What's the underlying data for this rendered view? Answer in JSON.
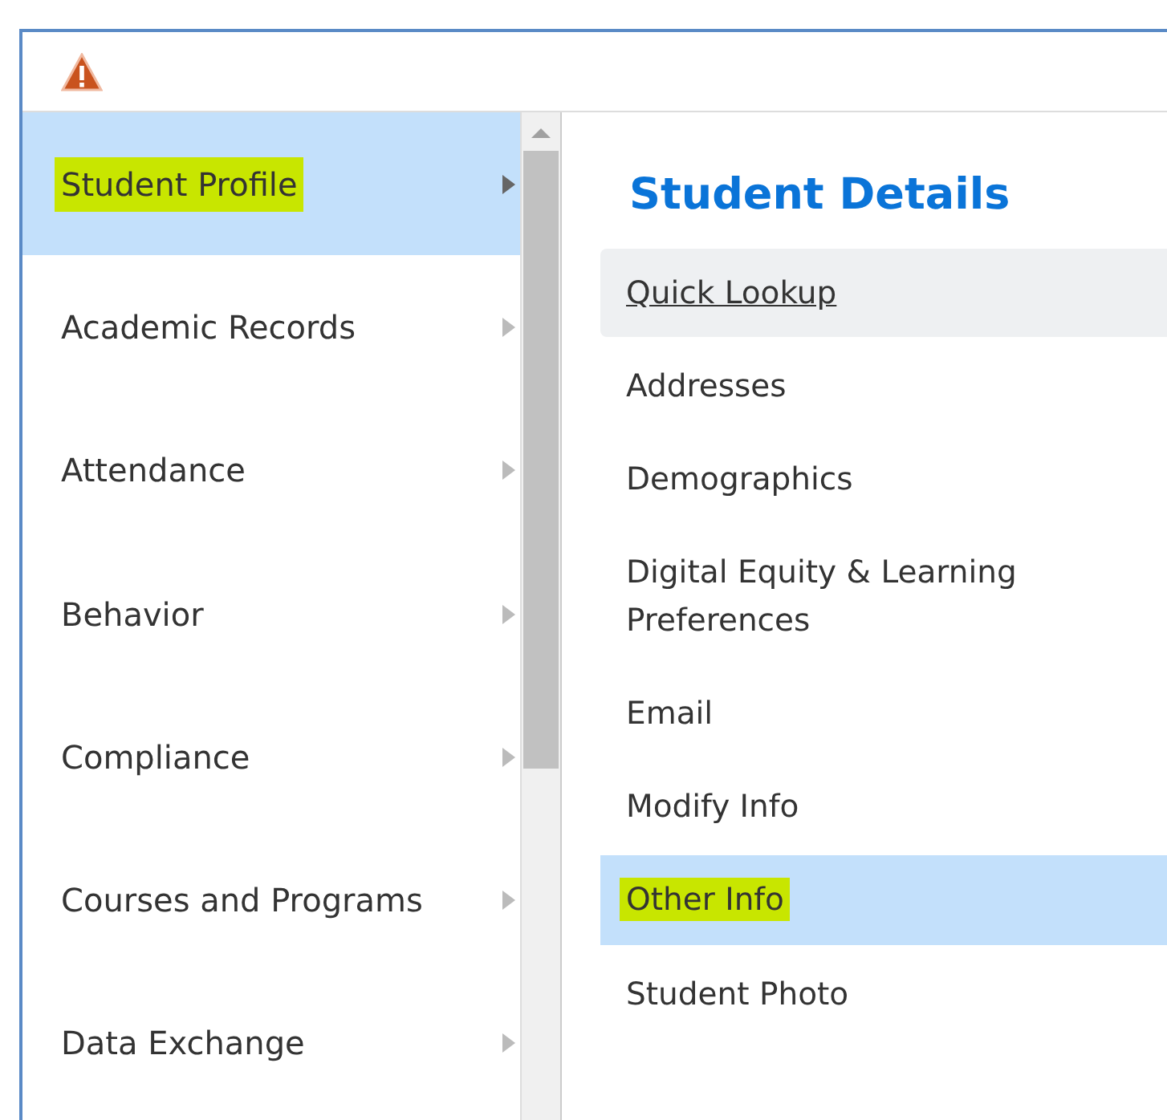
{
  "alert": {
    "kind": "warning"
  },
  "menu": {
    "items": [
      {
        "label": "Student Profile",
        "selected": true,
        "marked": true
      },
      {
        "label": "Academic Records",
        "selected": false,
        "marked": false
      },
      {
        "label": "Attendance",
        "selected": false,
        "marked": false
      },
      {
        "label": "Behavior",
        "selected": false,
        "marked": false
      },
      {
        "label": "Compliance",
        "selected": false,
        "marked": false
      },
      {
        "label": "Courses and Programs",
        "selected": false,
        "marked": false
      },
      {
        "label": "Data Exchange",
        "selected": false,
        "marked": false
      }
    ]
  },
  "submenu": {
    "title": "Student Details",
    "items": [
      {
        "label": "Quick Lookup",
        "hovered": true,
        "selected": false,
        "marked": false
      },
      {
        "label": "Addresses",
        "hovered": false,
        "selected": false,
        "marked": false
      },
      {
        "label": "Demographics",
        "hovered": false,
        "selected": false,
        "marked": false
      },
      {
        "label": "Digital Equity & Learning Preferences",
        "hovered": false,
        "selected": false,
        "marked": false
      },
      {
        "label": "Email",
        "hovered": false,
        "selected": false,
        "marked": false
      },
      {
        "label": "Modify Info",
        "hovered": false,
        "selected": false,
        "marked": false
      },
      {
        "label": "Other Info",
        "hovered": false,
        "selected": true,
        "marked": true
      },
      {
        "label": "Student Photo",
        "hovered": false,
        "selected": false,
        "marked": false
      }
    ]
  }
}
